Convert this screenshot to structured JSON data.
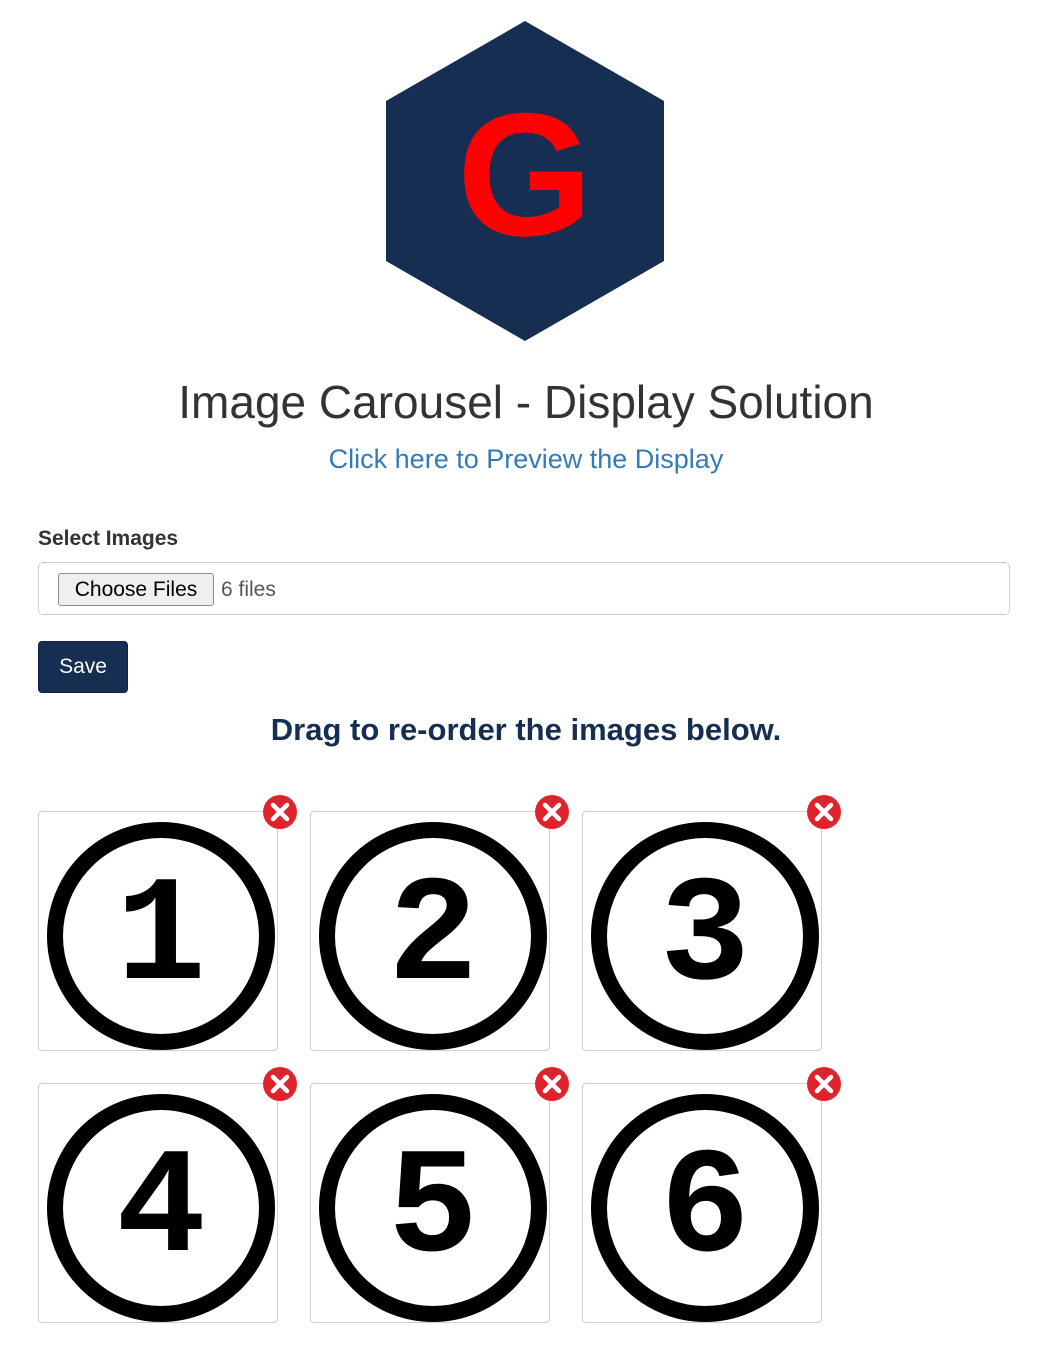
{
  "app": {
    "title": "Image Carousel - Display Solution",
    "preview_link": "Click here to Preview the Display",
    "logo_letter": "G"
  },
  "colors": {
    "logo_hexagon": "#162e52",
    "logo_letter": "#ff0000",
    "link": "#337ab7",
    "primary_button": "#162e52",
    "remove_icon": "#e0222b",
    "instructions_text": "#162e52"
  },
  "upload": {
    "label": "Select Images",
    "choose_button": "Choose Files",
    "file_count": "6 files"
  },
  "actions": {
    "save_label": "Save"
  },
  "gallery": {
    "instructions": "Drag to re-order the images below.",
    "images": [
      {
        "number": "1",
        "icon": "number-1-circle-icon",
        "remove_icon": "remove-x-circle-icon"
      },
      {
        "number": "2",
        "icon": "number-2-circle-icon",
        "remove_icon": "remove-x-circle-icon"
      },
      {
        "number": "3",
        "icon": "number-3-circle-icon",
        "remove_icon": "remove-x-circle-icon"
      },
      {
        "number": "4",
        "icon": "number-4-circle-icon",
        "remove_icon": "remove-x-circle-icon"
      },
      {
        "number": "5",
        "icon": "number-5-circle-icon",
        "remove_icon": "remove-x-circle-icon"
      },
      {
        "number": "6",
        "icon": "number-6-circle-icon",
        "remove_icon": "remove-x-circle-icon"
      }
    ]
  }
}
